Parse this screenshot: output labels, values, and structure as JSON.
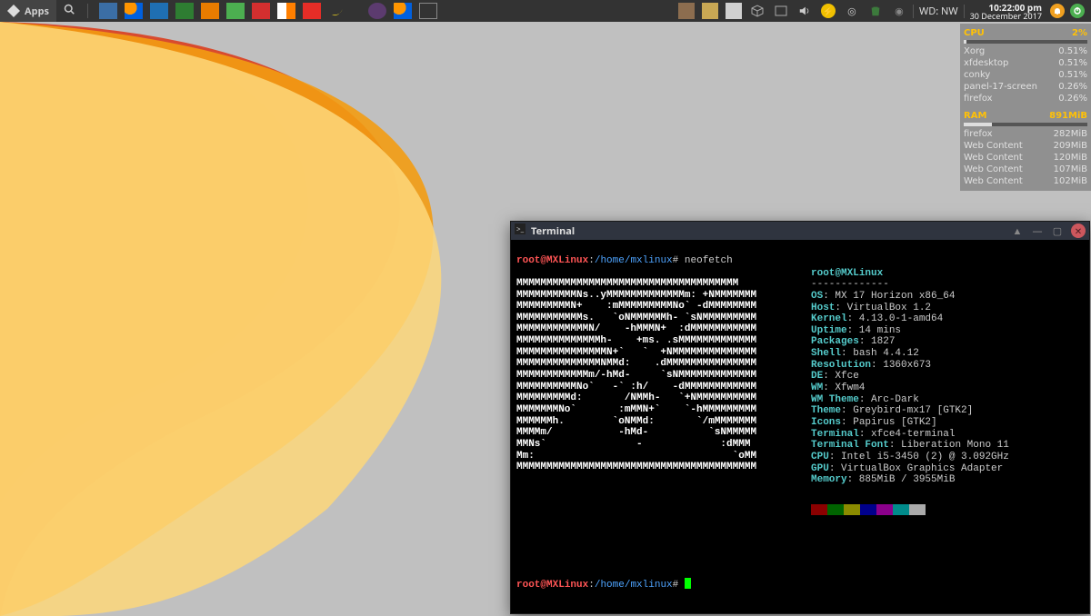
{
  "panel": {
    "apps_label": "Apps",
    "quicklaunch_icons": [
      "book-icon",
      "firefox-icon",
      "thunderbird-icon",
      "files-icon",
      "package-icon",
      "notes-icon",
      "calendar-icon",
      "vlc-icon",
      "youtube-icon",
      "banana-icon"
    ],
    "tasklist_icons": [
      "night-mode-icon",
      "firefox-task-icon",
      "terminal-task-icon"
    ],
    "tray_icons": [
      "book2-icon",
      "note-icon",
      "files2-icon",
      "box-icon",
      "workspace-icon",
      "volume-icon",
      "power-icon",
      "disc-icon",
      "trash-icon",
      "disc2-icon"
    ],
    "wd_label": "WD: NW",
    "time": "10:22:00 pm",
    "date": "30 December 2017"
  },
  "sysmon": {
    "cpu_label": "CPU",
    "cpu_value": "2%",
    "cpu_bar_pct": 2,
    "cpu_rows": [
      {
        "name": "Xorg",
        "val": "0.51%"
      },
      {
        "name": "xfdesktop",
        "val": "0.51%"
      },
      {
        "name": "conky",
        "val": "0.51%"
      },
      {
        "name": "panel-17-screen",
        "val": "0.26%"
      },
      {
        "name": "firefox",
        "val": "0.26%"
      }
    ],
    "ram_label": "RAM",
    "ram_value": "891MiB",
    "ram_bar_pct": 23,
    "ram_rows": [
      {
        "name": "firefox",
        "val": "282MiB"
      },
      {
        "name": "Web Content",
        "val": "209MiB"
      },
      {
        "name": "Web Content",
        "val": "120MiB"
      },
      {
        "name": "Web Content",
        "val": "107MiB"
      },
      {
        "name": "Web Content",
        "val": "102MiB"
      }
    ]
  },
  "terminal": {
    "title": "Terminal",
    "prompt_user": "root",
    "prompt_host": "MXLinux",
    "prompt_path": "/home/mxlinux",
    "prompt_suffix": "#",
    "command": "neofetch",
    "ascii": [
      "MMMMMMMMMMMMMMMMMMMMMMMMMMMMMMMMMMMMM",
      "MMMMMMMMMMNs..yMMMMMMMMMMMMMm: +NMMMMMMM",
      "MMMMMMMMMN+    :mMMMMMMMMMNo` -dMMMMMMMM",
      "MMMMMMMMMMMs.   `oNMMMMMMh- `sNMMMMMMMMM",
      "MMMMMMMMMMMMN/    -hMMMN+  :dMMMMMMMMMMM",
      "MMMMMMMMMMMMMMh-    +ms. .sMMMMMMMMMMMMM",
      "MMMMMMMMMMMMMMMN+`   `  +NMMMMMMMMMMMMMM",
      "MMMMMMMMMMMMMMNMMd:    .dMMMMMMMMMMMMMMM",
      "MMMMMMMMMMMMm/-hMd-     `sNMMMMMMMMMMMMM",
      "MMMMMMMMMMNo`   -` :h/    -dMMMMMMMMMMMM",
      "MMMMMMMMMd:       /NMMh-   `+NMMMMMMMMMM",
      "MMMMMMMNo`       :mMMN+`    `-hMMMMMMMMM",
      "MMMMMMh.        `oNMMd:       `/mMMMMMMM",
      "MMMMm/           -hMd-          `sNMMMMM",
      "MMNs`               -             :dMMM",
      "Mm:                                 `oMM",
      "MMMMMMMMMMMMMMMMMMMMMMMMMMMMMMMMMMMMMMMM"
    ],
    "info_header": "root@MXLinux",
    "info_sep": "-------------",
    "info": [
      {
        "k": "OS",
        "v": "MX 17 Horizon x86_64"
      },
      {
        "k": "Host",
        "v": "VirtualBox 1.2"
      },
      {
        "k": "Kernel",
        "v": "4.13.0-1-amd64"
      },
      {
        "k": "Uptime",
        "v": "14 mins"
      },
      {
        "k": "Packages",
        "v": "1827"
      },
      {
        "k": "Shell",
        "v": "bash 4.4.12"
      },
      {
        "k": "Resolution",
        "v": "1360x673"
      },
      {
        "k": "DE",
        "v": "Xfce"
      },
      {
        "k": "WM",
        "v": "Xfwm4"
      },
      {
        "k": "WM Theme",
        "v": "Arc-Dark"
      },
      {
        "k": "Theme",
        "v": "Greybird-mx17 [GTK2]"
      },
      {
        "k": "Icons",
        "v": "Papirus [GTK2]"
      },
      {
        "k": "Terminal",
        "v": "xfce4-terminal"
      },
      {
        "k": "Terminal Font",
        "v": "Liberation Mono 11"
      },
      {
        "k": "CPU",
        "v": "Intel i5-3450 (2) @ 3.092GHz"
      },
      {
        "k": "GPU",
        "v": "VirtualBox Graphics Adapter"
      },
      {
        "k": "Memory",
        "v": "885MiB / 3955MiB"
      }
    ],
    "swatches": [
      "#8b0000",
      "#006400",
      "#8b8b00",
      "#00008b",
      "#8b008b",
      "#008b8b",
      "#aaaaaa"
    ]
  }
}
